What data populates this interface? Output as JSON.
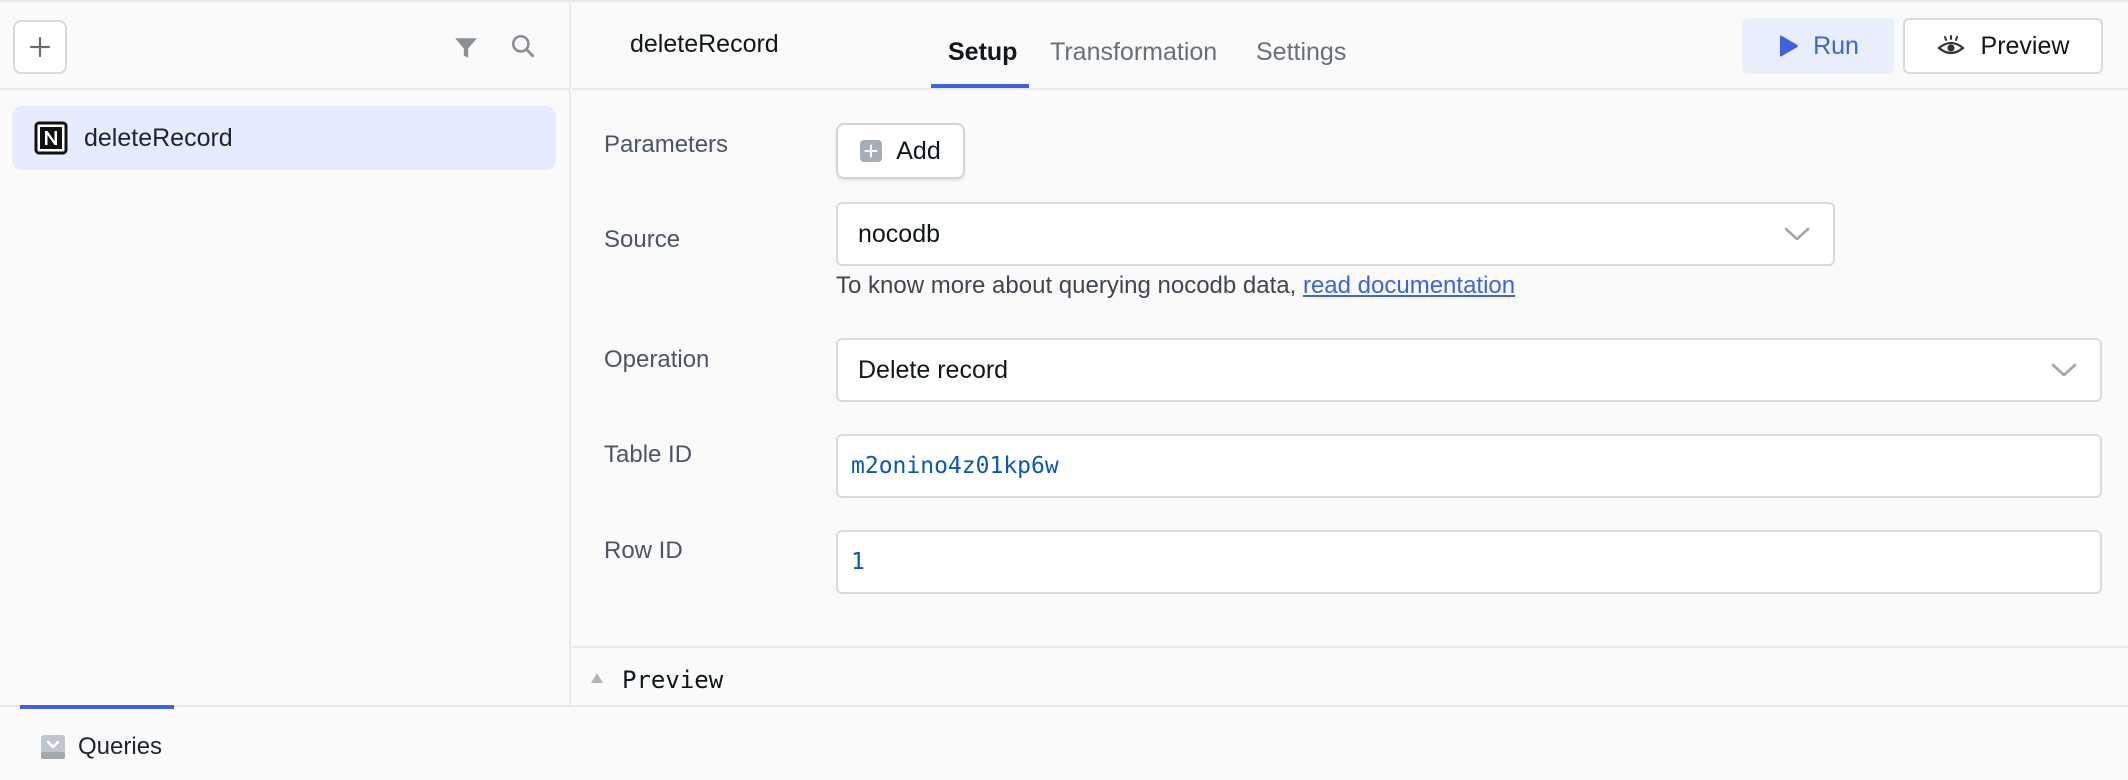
{
  "sidebar": {
    "items": [
      {
        "label": "deleteRecord",
        "icon": "notion-logo-icon",
        "selected": true
      }
    ]
  },
  "header": {
    "query_name": "deleteRecord",
    "tabs": [
      {
        "label": "Setup",
        "active": true
      },
      {
        "label": "Transformation",
        "active": false
      },
      {
        "label": "Settings",
        "active": false
      }
    ],
    "run_label": "Run",
    "preview_label": "Preview"
  },
  "form": {
    "parameters_label": "Parameters",
    "add_label": "Add",
    "source_label": "Source",
    "source_value": "nocodb",
    "hint_text": "To know more about querying nocodb data, ",
    "hint_link": "read documentation",
    "operation_label": "Operation",
    "operation_value": "Delete record",
    "table_id_label": "Table ID",
    "table_id_value": "m2onino4z01kp6w",
    "row_id_label": "Row ID",
    "row_id_value": "1"
  },
  "preview_bar": {
    "label": "Preview"
  },
  "bottom": {
    "queries_label": "Queries"
  },
  "colors": {
    "accent": "#3e63dd",
    "selected_bg": "#e6ecfd",
    "code_text": "#0b57b8"
  }
}
